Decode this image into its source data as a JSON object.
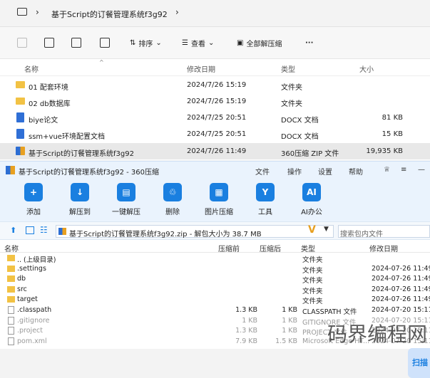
{
  "explorer": {
    "breadcrumb": "基于Script的订餐管理系统f3g92",
    "commands": {
      "sort": "排序",
      "view": "查看",
      "extract_all": "全部解压缩",
      "more": "···"
    },
    "columns": {
      "name": "名称",
      "modified": "修改日期",
      "type": "类型",
      "size": "大小"
    },
    "files": [
      {
        "name": "01 配套环境",
        "date": "2024/7/26 15:19",
        "type": "文件夹",
        "size": "",
        "icon": "folder"
      },
      {
        "name": "02 db数据库",
        "date": "2024/7/26 15:19",
        "type": "文件夹",
        "size": "",
        "icon": "folder"
      },
      {
        "name": "biye论文",
        "date": "2024/7/25 20:51",
        "type": "DOCX 文档",
        "size": "81 KB",
        "icon": "doc"
      },
      {
        "name": "ssm+vue环境配置文档",
        "date": "2024/7/25 20:51",
        "type": "DOCX 文档",
        "size": "15 KB",
        "icon": "doc"
      },
      {
        "name": "基于Script的订餐管理系统f3g92",
        "date": "2024/7/26 11:49",
        "type": "360压缩 ZIP 文件",
        "size": "19,935 KB",
        "icon": "zip"
      }
    ]
  },
  "zip": {
    "title": "基于Script的订餐管理系统f3g92 - 360压缩",
    "menu": [
      "文件",
      "操作",
      "设置",
      "帮助"
    ],
    "toolbar": [
      {
        "label": "添加",
        "glyph": "+"
      },
      {
        "label": "解压到",
        "glyph": "↓"
      },
      {
        "label": "一键解压",
        "glyph": "▤"
      },
      {
        "label": "删除",
        "glyph": "♲"
      },
      {
        "label": "图片压缩",
        "glyph": "▦"
      },
      {
        "label": "工具",
        "glyph": "Y"
      },
      {
        "label": "AI办公",
        "glyph": "AI"
      }
    ],
    "side_button": "扫描",
    "path": "基于Script的订餐管理系统f3g92.zip - 解包大小为 38.7 MB",
    "search_placeholder": "搜索包内文件",
    "columns": {
      "name": "名称",
      "compressed": "压缩前",
      "packed": "压缩后",
      "type": "类型",
      "modified": "修改日期"
    },
    "rows": [
      {
        "name": ".. (上级目录)",
        "before": "",
        "after": "",
        "type": "文件夹",
        "date": "",
        "icon": "folder",
        "grey": false
      },
      {
        "name": ".settings",
        "before": "",
        "after": "",
        "type": "文件夹",
        "date": "2024-07-26 11:49",
        "icon": "folder",
        "grey": false
      },
      {
        "name": "db",
        "before": "",
        "after": "",
        "type": "文件夹",
        "date": "2024-07-26 11:49",
        "icon": "folder",
        "grey": false
      },
      {
        "name": "src",
        "before": "",
        "after": "",
        "type": "文件夹",
        "date": "2024-07-26 11:49",
        "icon": "folder",
        "grey": false
      },
      {
        "name": "target",
        "before": "",
        "after": "",
        "type": "文件夹",
        "date": "2024-07-26 11:49",
        "icon": "folder",
        "grey": false
      },
      {
        "name": ".classpath",
        "before": "1.3 KB",
        "after": "1 KB",
        "type": "CLASSPATH 文件",
        "date": "2024-07-20 15:11",
        "icon": "doc",
        "grey": false
      },
      {
        "name": ".gitignore",
        "before": "1 KB",
        "after": "1 KB",
        "type": "GITIGNORE 文件",
        "date": "2024-07-20 15:11",
        "icon": "doc",
        "grey": true
      },
      {
        "name": ".project",
        "before": "1.3 KB",
        "after": "1 KB",
        "type": "PROJECT 文件",
        "date": "2024-07-20 15:11",
        "icon": "doc",
        "grey": true
      },
      {
        "name": "pom.xml",
        "before": "7.9 KB",
        "after": "1.5 KB",
        "type": "Microsoft Edge HT...",
        "date": "2024-07-20 15:11",
        "icon": "doc",
        "grey": true
      }
    ]
  },
  "watermark": "码界编程网"
}
